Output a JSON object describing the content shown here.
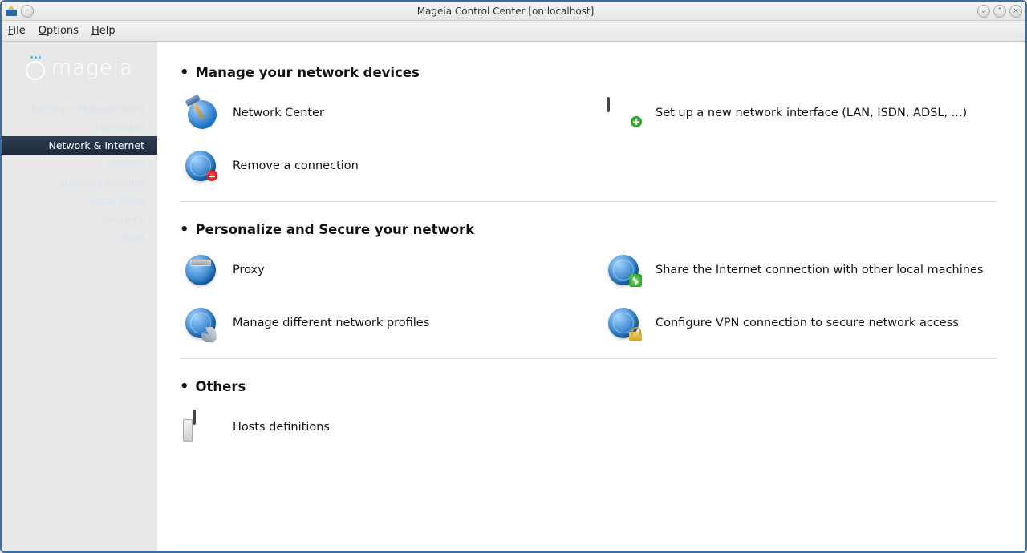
{
  "window": {
    "title": "Mageia Control Center  [on localhost]"
  },
  "menubar": {
    "file": "File",
    "options": "Options",
    "help": "Help"
  },
  "logo_text": "mageia",
  "sidebar": {
    "items": [
      {
        "label": "Software Management"
      },
      {
        "label": "Hardware"
      },
      {
        "label": "Network & Internet"
      },
      {
        "label": "System"
      },
      {
        "label": "Network Sharing"
      },
      {
        "label": "Local disks"
      },
      {
        "label": "Security"
      },
      {
        "label": "Boot"
      }
    ],
    "active_index": 2
  },
  "sections": [
    {
      "title": "Manage your network devices",
      "items": [
        {
          "icon": "network-center-icon",
          "label": "Network Center"
        },
        {
          "icon": "new-interface-icon",
          "label": "Set up a new network interface (LAN, ISDN, ADSL, ...)"
        },
        {
          "icon": "remove-connection-icon",
          "label": "Remove a connection"
        }
      ]
    },
    {
      "title": "Personalize and Secure your network",
      "items": [
        {
          "icon": "proxy-icon",
          "label": "Proxy"
        },
        {
          "icon": "share-internet-icon",
          "label": "Share the Internet connection with other local machines"
        },
        {
          "icon": "network-profiles-icon",
          "label": "Manage different network profiles"
        },
        {
          "icon": "vpn-icon",
          "label": "Configure VPN connection to secure network access"
        }
      ]
    },
    {
      "title": "Others",
      "items": [
        {
          "icon": "hosts-icon",
          "label": "Hosts definitions"
        }
      ]
    }
  ]
}
